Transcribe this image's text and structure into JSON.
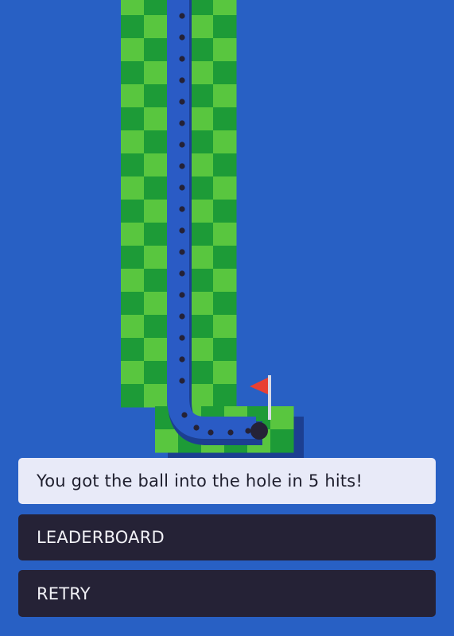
{
  "game": {
    "colors": {
      "background": "#2860c4",
      "grass_light": "#59c63f",
      "grass_dark": "#1d9b37",
      "trail": "#2a5bc5",
      "trail_shadow": "#1c3f91",
      "ball": "#252236",
      "flag": "#e84033",
      "flag_pole": "#d8dbe8"
    },
    "hits": 5
  },
  "message": {
    "text": "You got the ball into the hole in 5 hits!"
  },
  "buttons": {
    "leaderboard_label": "LEADERBOARD",
    "retry_label": "RETRY"
  }
}
